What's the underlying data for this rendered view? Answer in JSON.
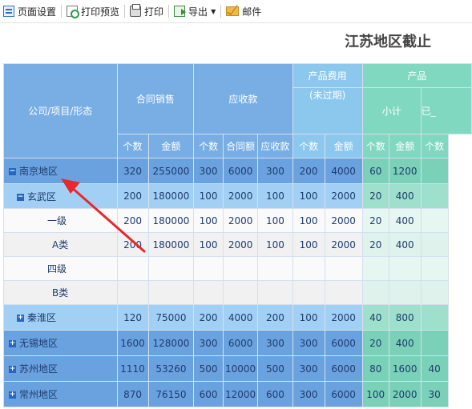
{
  "toolbar": {
    "page_setup": "页面设置",
    "print_preview": "打印预览",
    "print": "打印",
    "export": "导出",
    "mail": "邮件"
  },
  "report": {
    "title": "江苏地区截止",
    "headers": {
      "row_header": "公司/项目/形态",
      "contract_sales": "合同销售",
      "receivable": "应收款",
      "product_cost": "产品费用",
      "product_cost_note": "(未过期)",
      "product_partial": "产品",
      "subtotal": "小计",
      "already_partial": "已_",
      "sub": [
        "个数",
        "金额",
        "个数",
        "合同额",
        "应收款",
        "个数",
        "金额",
        "个数",
        "金额",
        "个数"
      ]
    },
    "rows": [
      {
        "name": "南京地区",
        "level": 0,
        "toggle": "−",
        "cells": [
          "320",
          "255000",
          "300",
          "6000",
          "300",
          "200",
          "4000",
          "60",
          "1200",
          ""
        ]
      },
      {
        "name": "玄武区",
        "level": 1,
        "toggle": "−",
        "cells": [
          "200",
          "180000",
          "100",
          "2000",
          "100",
          "100",
          "2000",
          "20",
          "400",
          ""
        ]
      },
      {
        "name": "一级",
        "level": 2,
        "toggle": "",
        "cells": [
          "200",
          "180000",
          "100",
          "2000",
          "100",
          "100",
          "2000",
          "20",
          "400",
          ""
        ]
      },
      {
        "name": "A类",
        "level": 3,
        "toggle": "",
        "cells": [
          "200",
          "180000",
          "100",
          "2000",
          "100",
          "100",
          "2000",
          "20",
          "400",
          ""
        ]
      },
      {
        "name": "四级",
        "level": 2,
        "toggle": "",
        "cells": [
          "",
          "",
          "",
          "",
          "",
          "",
          "",
          "",
          "",
          ""
        ]
      },
      {
        "name": "B类",
        "level": 3,
        "toggle": "",
        "cells": [
          "",
          "",
          "",
          "",
          "",
          "",
          "",
          "",
          "",
          ""
        ]
      },
      {
        "name": "秦淮区",
        "level": 1,
        "toggle": "+",
        "cells": [
          "120",
          "75000",
          "200",
          "4000",
          "200",
          "100",
          "2000",
          "40",
          "800",
          ""
        ]
      },
      {
        "name": "无锡地区",
        "level": 0,
        "toggle": "+",
        "cells": [
          "1600",
          "128000",
          "300",
          "6000",
          "300",
          "300",
          "6000",
          "20",
          "400",
          ""
        ]
      },
      {
        "name": "苏州地区",
        "level": 0,
        "toggle": "+",
        "cells": [
          "1110",
          "53260",
          "500",
          "10000",
          "500",
          "300",
          "6000",
          "80",
          "1600",
          "40"
        ]
      },
      {
        "name": "常州地区",
        "level": 0,
        "toggle": "+",
        "cells": [
          "870",
          "76150",
          "600",
          "12000",
          "600",
          "300",
          "6000",
          "100",
          "2000",
          "30"
        ]
      }
    ]
  },
  "colors": {
    "arrow": "#e8282b"
  }
}
